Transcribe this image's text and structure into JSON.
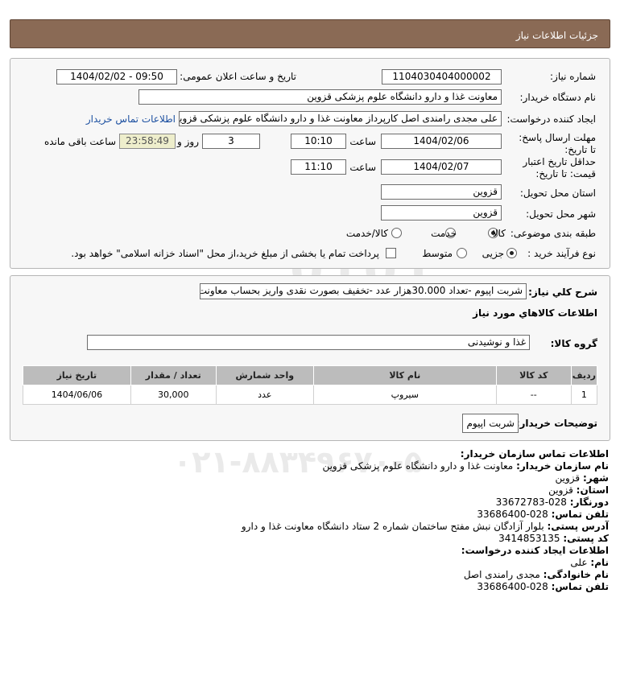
{
  "header": {
    "title": "جزئیات اطلاعات نیاز"
  },
  "form": {
    "need_number": {
      "label": "شماره نیاز:",
      "value": "1104030404000002"
    },
    "announce_datetime": {
      "label": "تاریخ و ساعت اعلان عمومی:",
      "value": "1404/02/02 - 09:50"
    },
    "buyer_org": {
      "label": "نام دستگاه خریدار:",
      "value": "معاونت غذا و دارو دانشگاه علوم پزشکی قزوین"
    },
    "requester": {
      "label": "ایجاد کننده درخواست:",
      "value": "علی مجدی رامندی اصل کارپرداز معاونت غذا و دارو دانشگاه علوم پزشکی قزوین",
      "contact_link": "اطلاعات تماس خریدار"
    },
    "reply_deadline": {
      "label": "مهلت ارسال پاسخ: تا تاریخ:",
      "date": "1404/02/06",
      "time_label": "ساعت",
      "time": "10:10",
      "days": "3",
      "days_label": "روز و",
      "remaining": "23:58:49",
      "remaining_label": "ساعت باقی مانده"
    },
    "price_validity": {
      "label": "حداقل تاریخ اعتبار قیمت: تا تاریخ:",
      "date": "1404/02/07",
      "time_label": "ساعت",
      "time": "11:10"
    },
    "delivery_province": {
      "label": "استان محل تحویل:",
      "value": "قزوین"
    },
    "delivery_city": {
      "label": "شهر محل تحویل:",
      "value": "قزوین"
    },
    "category": {
      "label": "طبقه بندی موضوعی:",
      "options": [
        "کالا",
        "خدمت",
        "کالا/خدمت"
      ],
      "selected": "کالا"
    },
    "purchase_type": {
      "label": "نوع فرآیند خرید :",
      "options": [
        "جزیی",
        "متوسط"
      ],
      "selected": "جزیی",
      "check_label": "پرداخت تمام یا بخشی از مبلغ خرید،از محل \"اسناد خزانه اسلامی\" خواهد بود."
    }
  },
  "general": {
    "desc_label": "شرح کلي نياز:",
    "desc_value": "شربت اپیوم -تعداد 30.000هزار عدد -تخفیف بصورت نقدی واریز بحساب معاونت -",
    "goods_info_title": "اطلاعات کالاهاي مورد نياز",
    "goods_group_label": "گروه کالا:",
    "goods_group_value": "غذا و نوشیدنی",
    "table": {
      "headers": [
        "ردیف",
        "کد کالا",
        "نام کالا",
        "واحد شمارش",
        "تعداد / مقدار",
        "تاریخ نیاز"
      ],
      "rows": [
        [
          "1",
          "--",
          "سیروپ",
          "عدد",
          "30,000",
          "1404/06/06"
        ]
      ]
    },
    "buyer_notes_label": "توضیحات خریدار:",
    "buyer_notes_value": "شربت اپیوم"
  },
  "contact": {
    "title": "اطلاعات تماس سازمان خریدار:",
    "org_label": "نام سازمان خریدار:",
    "org_value": "معاونت غذا و دارو دانشگاه علوم پزشکی قزوین",
    "city_label": "شهر:",
    "city_value": "قزوین",
    "province_label": "استان:",
    "province_value": "قزوین",
    "fax_label": "دورنگار:",
    "fax_value": "028-33672783",
    "phone_label": "تلفن تماس:",
    "phone_value": "028-33686400",
    "address_label": "آدرس پستی:",
    "address_value": "بلوار آزادگان نبش مفتح ساختمان شماره 2 ستاد دانشگاه معاونت غذا و دارو",
    "postal_label": "کد پستی:",
    "postal_value": "3414853135",
    "creator_title": "اطلاعات ایجاد کننده درخواست:",
    "name_label": "نام:",
    "name_value": "علی",
    "family_label": "نام خانوادگی:",
    "family_value": "مجدی رامندی اصل",
    "creator_phone_label": "تلفن تماس:",
    "creator_phone_value": "028-33686400"
  },
  "watermark": {
    "brand": "ParsNamadData",
    "line1": "مرکز فرآوری اطلاعات پارس نماد داده ها",
    "line2": "پایگاه اطلاع رسانی مناقصه و مزایده",
    "phone": "۰۲۱-۸۸۳۴۹۶۷۰-۵"
  }
}
